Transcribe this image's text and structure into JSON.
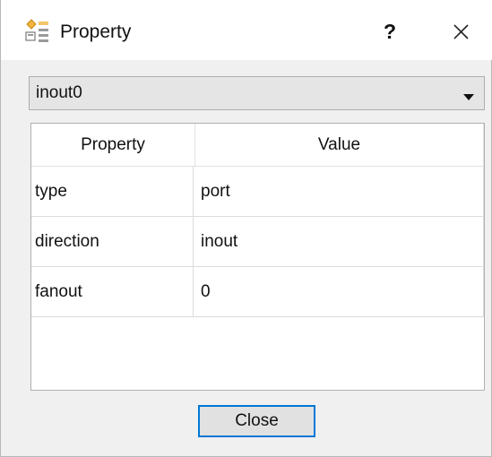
{
  "window": {
    "title": "Property",
    "help_label": "?"
  },
  "icons": {
    "app": "property-app-icon",
    "close": "close-icon",
    "dropdown": "chevron-down-icon"
  },
  "selector": {
    "selected": "inout0"
  },
  "table": {
    "headers": [
      "Property",
      "Value"
    ],
    "rows": [
      {
        "property": "type",
        "value": "port"
      },
      {
        "property": "direction",
        "value": "inout"
      },
      {
        "property": "fanout",
        "value": "0"
      }
    ]
  },
  "buttons": {
    "close_label": "Close"
  },
  "colors": {
    "accent": "#0078d7",
    "button_bg": "#e1e1e1",
    "dialog_bg": "#f0f0f0"
  }
}
